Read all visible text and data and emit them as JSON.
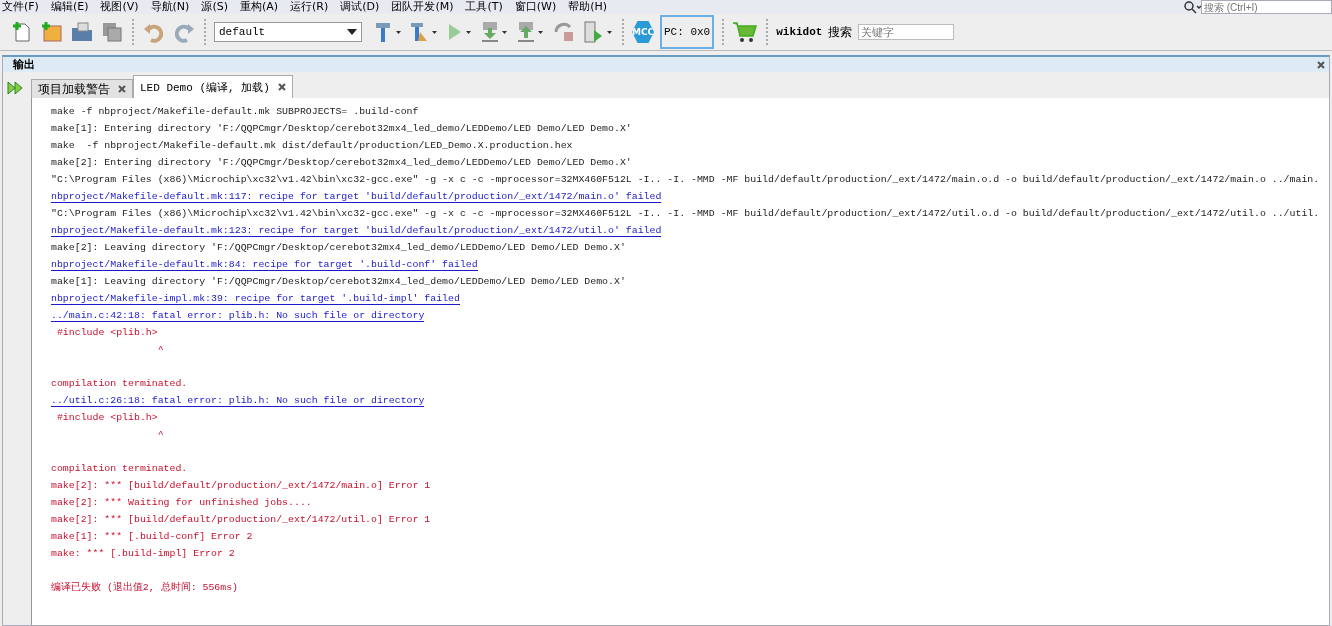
{
  "menu": [
    "文件(F)",
    "编辑(E)",
    "视图(V)",
    "导航(N)",
    "源(S)",
    "重构(A)",
    "运行(R)",
    "调试(D)",
    "团队开发(M)",
    "工具(T)",
    "窗口(W)",
    "帮助(H)"
  ],
  "global_search": {
    "placeholder": "搜索 (Ctrl+I)"
  },
  "toolbar": {
    "configuration": "default",
    "pc": "PC: 0x0",
    "wikidot_label": "wikidot",
    "search_label": "搜索",
    "search_placeholder": "关键字",
    "mcc": "MCC"
  },
  "output": {
    "title": "输出",
    "tabs": [
      {
        "label": "项目加载警告",
        "selected": false
      },
      {
        "label": "LED Demo (编译, 加载)",
        "selected": true
      }
    ],
    "lines": [
      {
        "kind": "plain",
        "text": "make -f nbproject/Makefile-default.mk SUBPROJECTS= .build-conf"
      },
      {
        "kind": "plain",
        "text": "make[1]: Entering directory 'F:/QQPCmgr/Desktop/cerebot32mx4_led_demo/LEDDemo/LED Demo/LED Demo.X'"
      },
      {
        "kind": "plain",
        "text": "make  -f nbproject/Makefile-default.mk dist/default/production/LED_Demo.X.production.hex"
      },
      {
        "kind": "plain",
        "text": "make[2]: Entering directory 'F:/QQPCmgr/Desktop/cerebot32mx4_led_demo/LEDDemo/LED Demo/LED Demo.X'"
      },
      {
        "kind": "plain",
        "text": "\"C:\\Program Files (x86)\\Microchip\\xc32\\v1.42\\bin\\xc32-gcc.exe\" -g -x c -c -mprocessor=32MX460F512L -I.. -I. -MMD -MF build/default/production/_ext/1472/main.o.d -o build/default/production/_ext/1472/main.o ../main."
      },
      {
        "kind": "link",
        "text": "nbproject/Makefile-default.mk:117: recipe for target 'build/default/production/_ext/1472/main.o' failed"
      },
      {
        "kind": "plain",
        "text": "\"C:\\Program Files (x86)\\Microchip\\xc32\\v1.42\\bin\\xc32-gcc.exe\" -g -x c -c -mprocessor=32MX460F512L -I.. -I. -MMD -MF build/default/production/_ext/1472/util.o.d -o build/default/production/_ext/1472/util.o ../util."
      },
      {
        "kind": "link",
        "text": "nbproject/Makefile-default.mk:123: recipe for target 'build/default/production/_ext/1472/util.o' failed"
      },
      {
        "kind": "plain",
        "text": "make[2]: Leaving directory 'F:/QQPCmgr/Desktop/cerebot32mx4_led_demo/LEDDemo/LED Demo/LED Demo.X'"
      },
      {
        "kind": "link",
        "text": "nbproject/Makefile-default.mk:84: recipe for target '.build-conf' failed"
      },
      {
        "kind": "plain",
        "text": "make[1]: Leaving directory 'F:/QQPCmgr/Desktop/cerebot32mx4_led_demo/LEDDemo/LED Demo/LED Demo.X'"
      },
      {
        "kind": "link",
        "text": "nbproject/Makefile-impl.mk:39: recipe for target '.build-impl' failed"
      },
      {
        "kind": "link",
        "text": "../main.c:42:18: fatal error: plib.h: No such file or directory"
      },
      {
        "kind": "error",
        "text": " #include <plib.h>"
      },
      {
        "kind": "error",
        "text": "                  ^"
      },
      {
        "kind": "blank"
      },
      {
        "kind": "error",
        "text": "compilation terminated."
      },
      {
        "kind": "link",
        "text": "../util.c:26:18: fatal error: plib.h: No such file or directory"
      },
      {
        "kind": "error",
        "text": " #include <plib.h>"
      },
      {
        "kind": "error",
        "text": "                  ^"
      },
      {
        "kind": "blank"
      },
      {
        "kind": "error",
        "text": "compilation terminated."
      },
      {
        "kind": "error",
        "text": "make[2]: *** [build/default/production/_ext/1472/main.o] Error 1"
      },
      {
        "kind": "error",
        "text": "make[2]: *** Waiting for unfinished jobs...."
      },
      {
        "kind": "error",
        "text": "make[2]: *** [build/default/production/_ext/1472/util.o] Error 1"
      },
      {
        "kind": "error",
        "text": "make[1]: *** [.build-conf] Error 2"
      },
      {
        "kind": "error",
        "text": "make: *** [.build-impl] Error 2"
      },
      {
        "kind": "blank"
      },
      {
        "kind": "error",
        "text": "编译已失败 (退出值2, 总时间: 556ms)"
      }
    ]
  }
}
